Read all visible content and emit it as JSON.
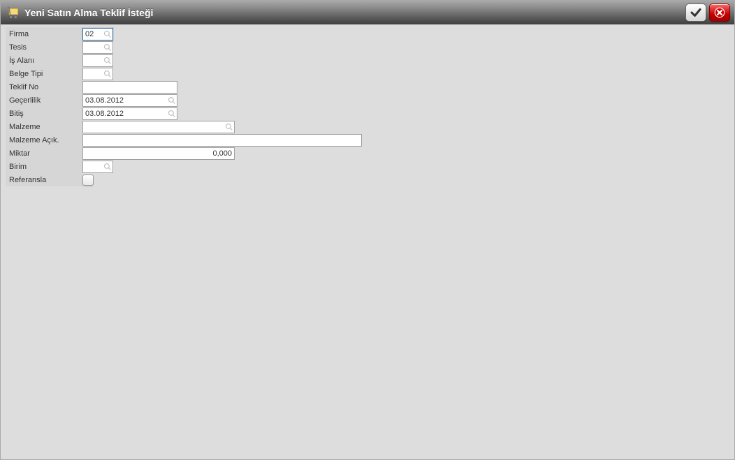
{
  "window": {
    "title": "Yeni Satın Alma Teklif İsteği"
  },
  "form": {
    "firma": {
      "label": "Firma",
      "value": "02"
    },
    "tesis": {
      "label": "Tesis",
      "value": ""
    },
    "is_alani": {
      "label": "İş Alanı",
      "value": ""
    },
    "belge_tipi": {
      "label": "Belge Tipi",
      "value": ""
    },
    "teklif_no": {
      "label": "Teklif No",
      "value": ""
    },
    "gecerlilik": {
      "label": "Geçerlilik",
      "value": "03.08.2012"
    },
    "bitis": {
      "label": "Bitiş",
      "value": "03.08.2012"
    },
    "malzeme": {
      "label": "Malzeme",
      "value": ""
    },
    "malzeme_acik": {
      "label": "Malzeme Açık.",
      "value": ""
    },
    "miktar": {
      "label": "Miktar",
      "value": "0,000"
    },
    "birim": {
      "label": "Birim",
      "value": ""
    },
    "referansla": {
      "label": "Referansla",
      "checked": false
    }
  }
}
